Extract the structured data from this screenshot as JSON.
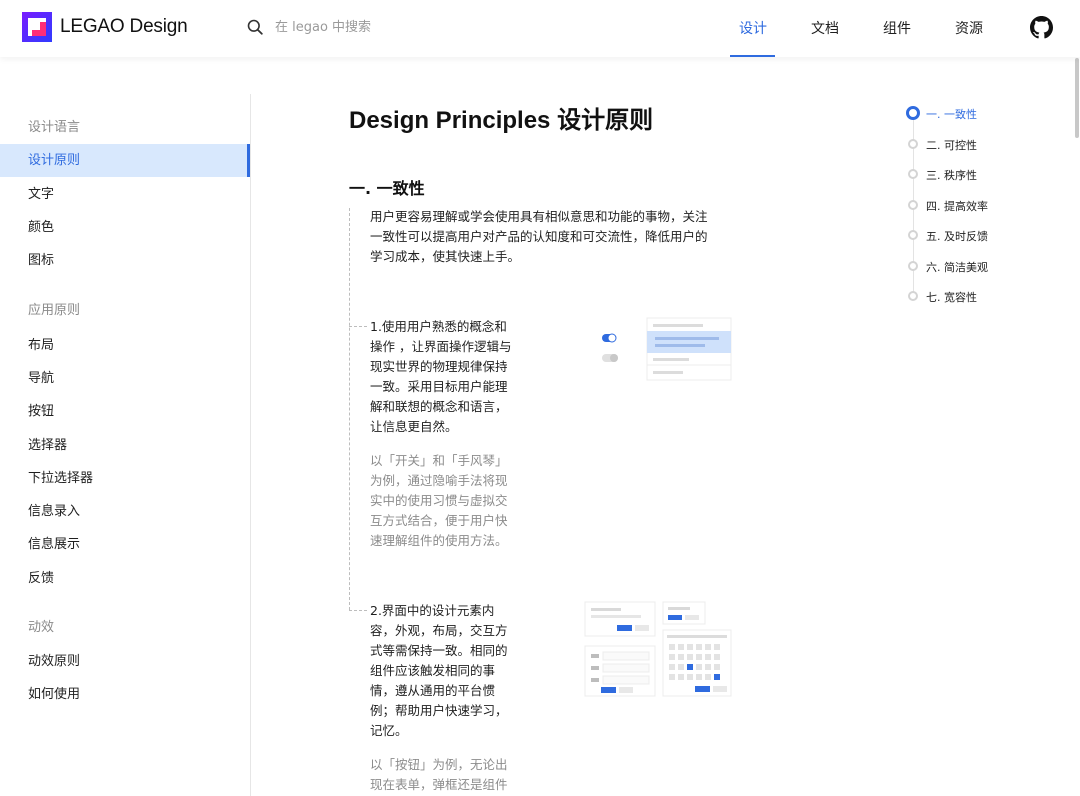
{
  "header": {
    "logo_text": "LEGAO Design",
    "search_placeholder": "在 legao 中搜索",
    "nav": [
      "设计",
      "文档",
      "组件",
      "资源"
    ],
    "active_nav": "设计"
  },
  "sidebar": {
    "groups": [
      {
        "title": "设计语言",
        "items": [
          "设计原则",
          "文字",
          "颜色",
          "图标"
        ]
      },
      {
        "title": "应用原则",
        "items": [
          "布局",
          "导航",
          "按钮",
          "选择器",
          "下拉选择器",
          "信息录入",
          "信息展示",
          "反馈"
        ]
      },
      {
        "title": "动效",
        "items": [
          "动效原则",
          "如何使用"
        ]
      }
    ],
    "active_item": "设计原则"
  },
  "content": {
    "page_title": "Design Principles 设计原则",
    "section_title": "一. 一致性",
    "intro_lines": [
      "用户更容易理解或学会使用具有相似意思和功能的事物，关注",
      "一致性可以提高用户对产品的认知度和可交流性，降低用户的",
      "学习成本，使其快速上手。"
    ],
    "point1_lines": [
      "1.使用用户熟悉的概念和",
      "操作 ，让界面操作逻辑与",
      "现实世界的物理规律保持",
      "一致。采用目标用户能理",
      "解和联想的概念和语言，",
      "让信息更自然。"
    ],
    "point1_example_lines": [
      "以「开关」和「手风琴」",
      "为例，通过隐喻手法将现",
      "实中的使用习惯与虚拟交",
      "互方式结合，便于用户快",
      "速理解组件的使用方法。"
    ],
    "point2_lines": [
      "2.界面中的设计元素内",
      "容，外观，布局，交互方",
      "式等需保持一致。相同的",
      "组件应该触发相同的事",
      "情，遵从通用的平台惯",
      "例；帮助用户快速学习，",
      "记忆。"
    ],
    "point2_example_lines": [
      "以「按钮」为例，无论出",
      "现在表单，弹框还是组件"
    ]
  },
  "toc": {
    "items": [
      "一. 一致性",
      "二. 可控性",
      "三. 秩序性",
      "四. 提高效率",
      "五. 及时反馈",
      "六. 简洁美观",
      "七. 宽容性"
    ],
    "active_index": 0
  },
  "colors": {
    "accent": "#2f6bdf",
    "sidebar_active_bg": "#d8e8fd",
    "text": "#1f1f1f",
    "muted": "#8c8c8c"
  }
}
